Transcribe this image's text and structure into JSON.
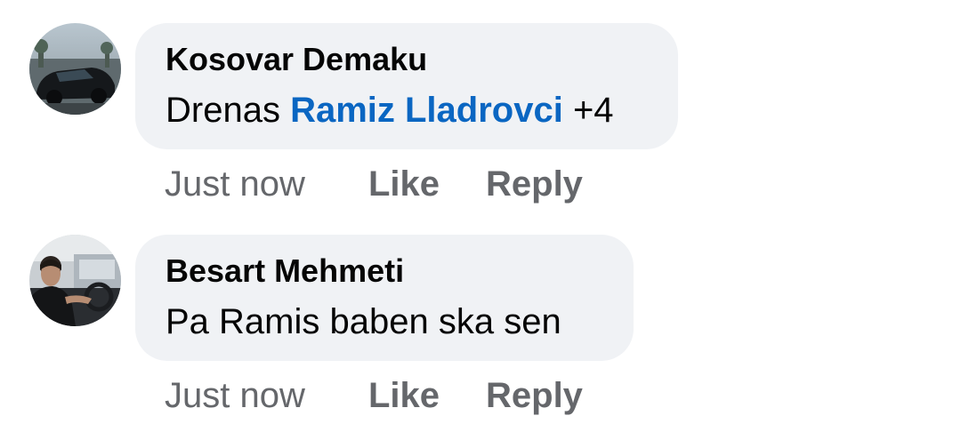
{
  "comments": [
    {
      "author": "Kosovar Demaku",
      "text_prefix": "Drenas ",
      "mention": "Ramiz Lladrovci",
      "text_suffix": " +4",
      "timestamp": "Just now",
      "like_label": "Like",
      "reply_label": "Reply",
      "avatar_icon": "profile-photo-car"
    },
    {
      "author": "Besart Mehmeti",
      "text": "Pa Ramis baben ska sen",
      "timestamp": "Just now",
      "like_label": "Like",
      "reply_label": "Reply",
      "avatar_icon": "profile-photo-person-in-car"
    }
  ],
  "colors": {
    "bubble_bg": "#f0f2f5",
    "text": "#050505",
    "secondary_text": "#65676b",
    "mention": "#0a66c2"
  }
}
